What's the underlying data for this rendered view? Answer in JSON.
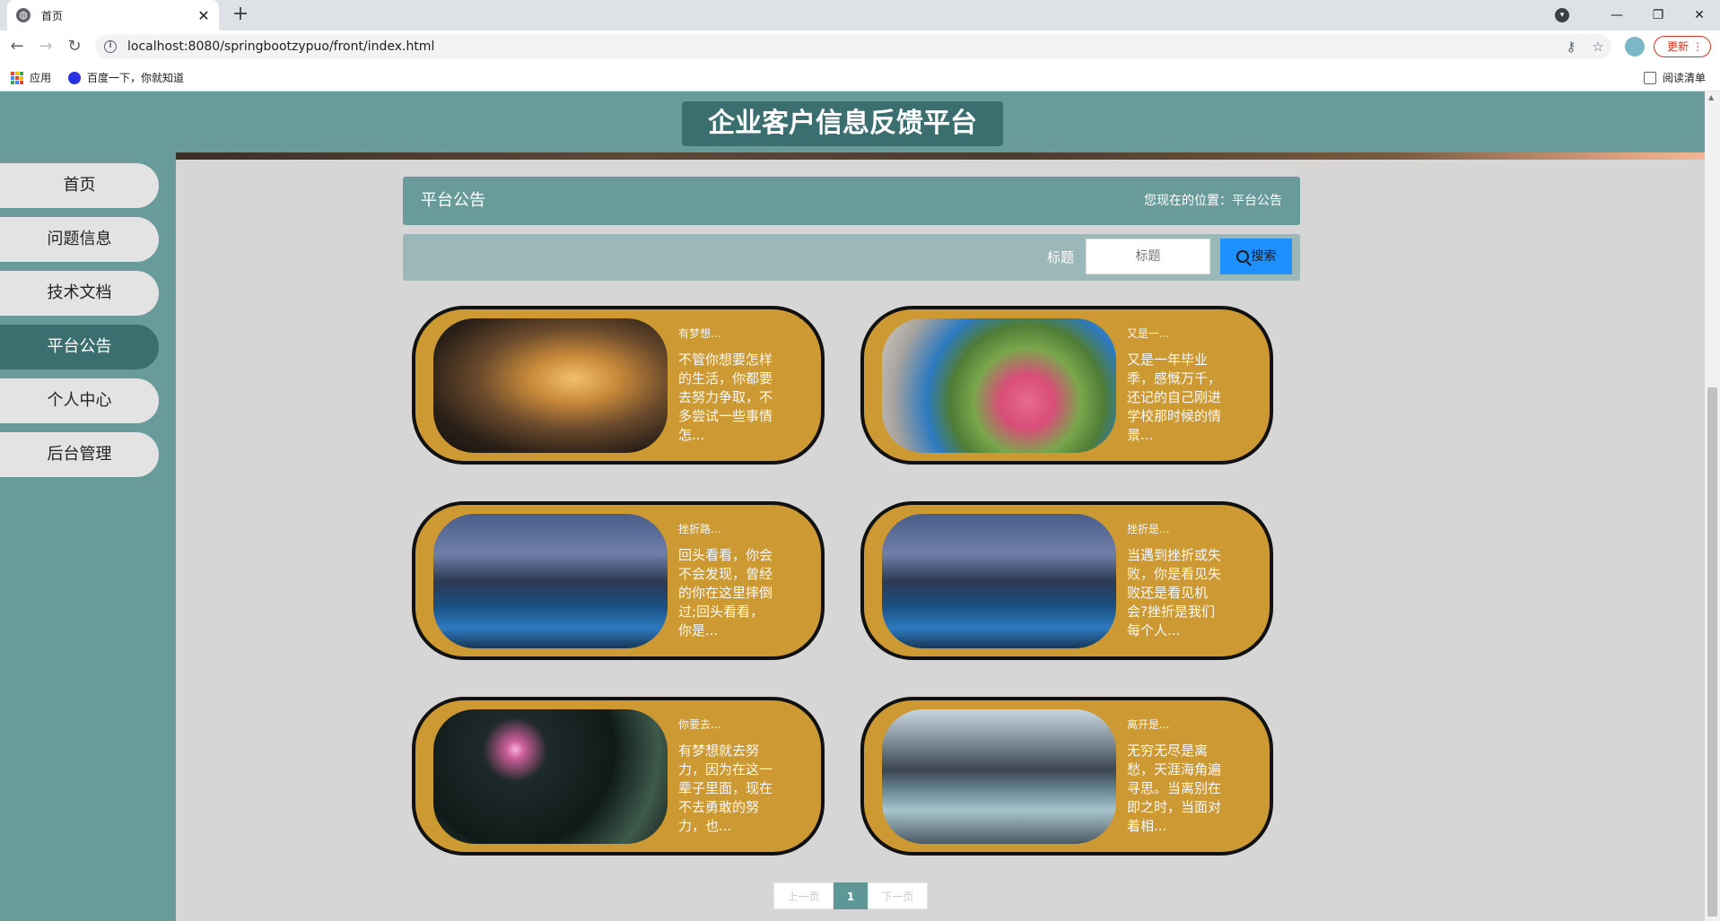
{
  "browser": {
    "tab_title": "首页",
    "tab_close": "✕",
    "new_tab": "+",
    "url": "localhost:8080/springbootzypuo/front/index.html",
    "update_label": "更新",
    "window_controls": {
      "minimize": "—",
      "restore": "❐",
      "close": "✕"
    },
    "bookmarks": [
      {
        "label": "应用",
        "icon": "apps-grid-icon"
      },
      {
        "label": "百度一下，你就知道",
        "icon": "baidu-paw-icon"
      }
    ],
    "reading_list": "阅读清单"
  },
  "site": {
    "title": "企业客户信息反馈平台",
    "accent": "#6a9b9b",
    "active": "#3b6e6e",
    "card_color": "#cc9932"
  },
  "sidebar": {
    "items": [
      {
        "label": "首页",
        "active": false
      },
      {
        "label": "问题信息",
        "active": false
      },
      {
        "label": "技术文档",
        "active": false
      },
      {
        "label": "平台公告",
        "active": true
      },
      {
        "label": "个人中心",
        "active": false
      },
      {
        "label": "后台管理",
        "active": false
      }
    ]
  },
  "notice": {
    "title": "平台公告",
    "breadcrumb": "您现在的位置：平台公告"
  },
  "search": {
    "label": "标题",
    "placeholder": "标题",
    "button": "搜索"
  },
  "cards": [
    {
      "title": "有梦想...",
      "desc": "不管你想要怎样的生活，你都要去努力争取，不多尝试一些事情怎...",
      "image": "lone-tree-sunset"
    },
    {
      "title": "又是一...",
      "desc": "又是一年毕业季，感慨万千，还记的自己刚进学校那时候的情景...",
      "image": "pink-roses-blue-can"
    },
    {
      "title": "挫折路...",
      "desc": "回头看看，你会不会发现，曾经的你在这里摔倒过;回头看看，你是...",
      "image": "mountain-lake"
    },
    {
      "title": "挫折是...",
      "desc": "当遇到挫折或失败，你是看见失败还是看见机会?挫折是我们每个人...",
      "image": "mountain-lake"
    },
    {
      "title": "你要去...",
      "desc": "有梦想就去努力，因为在这一辈子里面，现在不去勇敢的努力，也...",
      "image": "night-crescent-moon"
    },
    {
      "title": "离开是...",
      "desc": "无穷无尽是离愁，天涯海角遍寻思。当离别在即之时，当面对着相...",
      "image": "mountain-river"
    }
  ],
  "pager": {
    "prev": "上一页",
    "current": "1",
    "next": "下一页"
  }
}
